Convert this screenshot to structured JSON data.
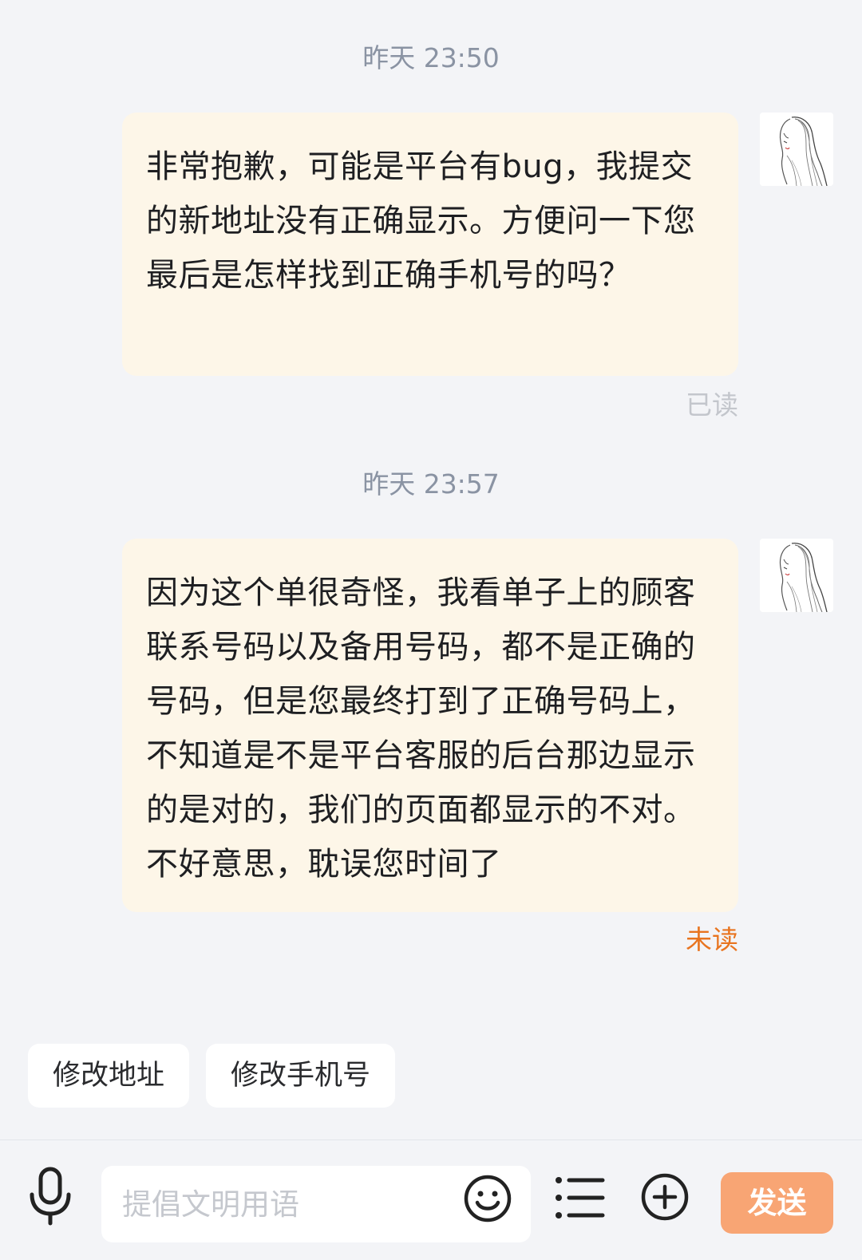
{
  "messages": [
    {
      "timestamp": "昨天 23:50",
      "text": "非常抱歉，可能是平台有bug，我提交的新地址没有正确显示。方便问一下您最后是怎样找到正确手机号的吗？",
      "status": "已读"
    },
    {
      "timestamp": "昨天 23:57",
      "text": "因为这个单很奇怪，我看单子上的顾客联系号码以及备用号码，都不是正确的号码，但是您最终打到了正确号码上，不知道是不是平台客服的后台那边显示的是对的，我们的页面都显示的不对。不好意思，耽误您时间了",
      "status": "未读"
    }
  ],
  "quick_replies": [
    "修改地址",
    "修改手机号"
  ],
  "input": {
    "placeholder": "提倡文明用语",
    "value": ""
  },
  "send_label": "发送",
  "icons": {
    "avatar": "sketch-portrait-avatar",
    "mic": "microphone-icon",
    "emoji": "smiley-face-icon",
    "list": "list-menu-icon",
    "plus": "plus-circle-icon"
  },
  "colors": {
    "bubble": "#fdf6e8",
    "unread": "#e8741f",
    "read": "#c3c6cc",
    "send_button": "#f8a574",
    "timestamp": "#8a93a3"
  }
}
